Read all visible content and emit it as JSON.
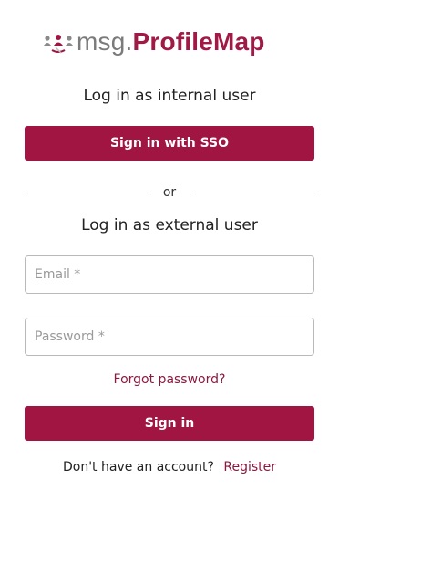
{
  "brand": {
    "logo_icon": "people-network-icon",
    "prefix": "msg.",
    "name": "ProfileMap",
    "accent_color": "#a01541"
  },
  "internal": {
    "heading": "Log in as internal user",
    "sso_button": "Sign in with SSO"
  },
  "divider": {
    "label": "or"
  },
  "external": {
    "heading": "Log in as external user",
    "email_placeholder": "Email *",
    "email_value": "",
    "password_placeholder": "Password *",
    "password_value": "",
    "forgot_link": "Forgot password?",
    "sign_in_button": "Sign in"
  },
  "register": {
    "prompt": "Don't have an account?",
    "link": "Register"
  }
}
